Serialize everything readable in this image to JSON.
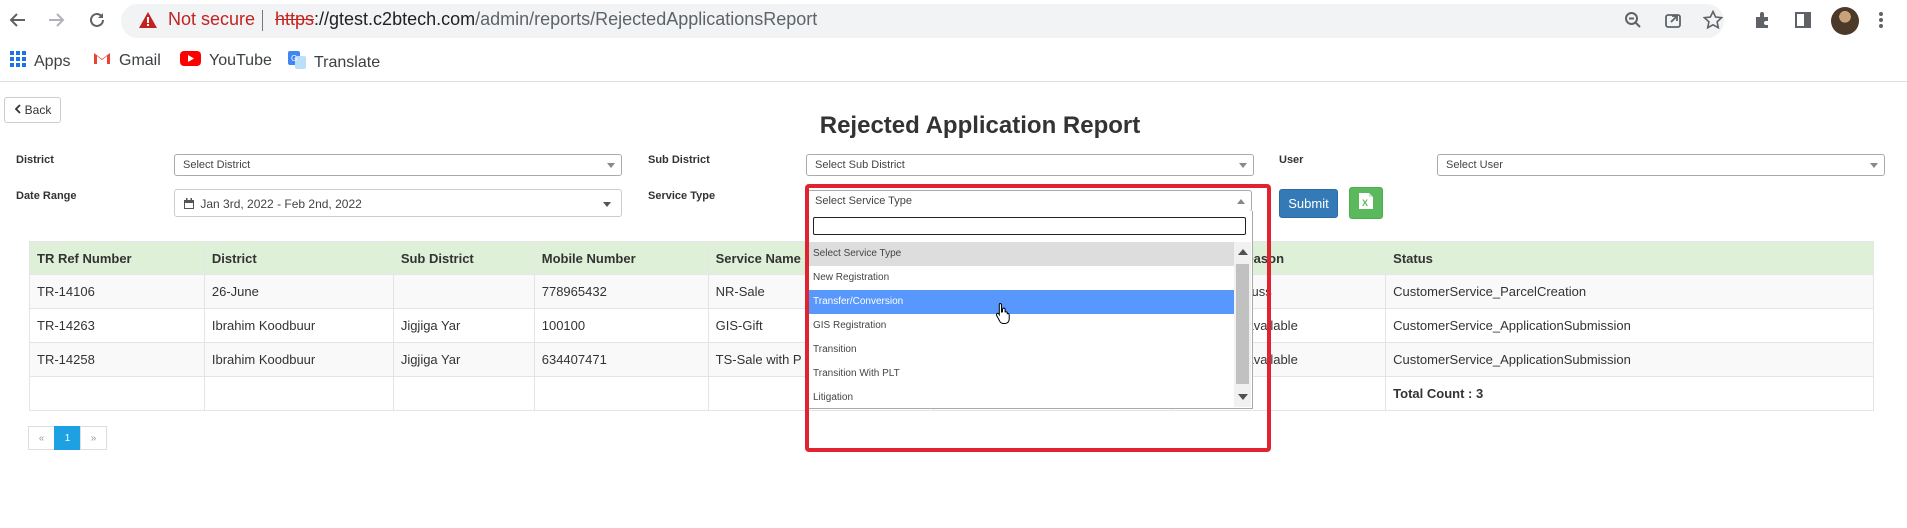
{
  "browser": {
    "not_secure": "Not secure",
    "url_scheme": "https",
    "url_host": "://gtest.c2btech.com",
    "url_path": "/admin/reports/RejectedApplicationsReport",
    "bookmarks": [
      "Apps",
      "Gmail",
      "YouTube",
      "Translate"
    ]
  },
  "page": {
    "back_label": "Back",
    "title": "Rejected Application Report"
  },
  "filters": {
    "district_label": "District",
    "district_value": "Select District",
    "subdistrict_label": "Sub District",
    "subdistrict_value": "Select Sub District",
    "user_label": "User",
    "user_value": "Select User",
    "date_label": "Date Range",
    "date_value": "Jan 3rd, 2022 - Feb 2nd, 2022",
    "service_label": "Service Type",
    "service_value": "Select Service Type",
    "submit_label": "Submit"
  },
  "service_dropdown": {
    "search_value": "",
    "options": [
      "Select Service Type",
      "New Registration",
      "Transfer/Conversion",
      "GIS Registration",
      "Transition",
      "Transition With PLT",
      "Litigation"
    ],
    "selected_index": 0,
    "hover_index": 2
  },
  "table": {
    "headers": [
      "TR Ref Number",
      "District",
      "Sub District",
      "Mobile Number",
      "Service Name",
      "",
      "Rejected Reason",
      "Status"
    ],
    "rows": [
      [
        "TR-14106",
        "26-June",
        "",
        "778965432",
        "NR-Sale",
        "",
        "Need to discuss",
        "CustomerService_ParcelCreation"
      ],
      [
        "TR-14263",
        "Ibrahim Koodbuur",
        "Jigjiga Yar",
        "100100",
        "GIS-Gift",
        "",
        "Legacy not available",
        "CustomerService_ApplicationSubmission"
      ],
      [
        "TR-14258",
        "Ibrahim Koodbuur",
        "Jigjiga Yar",
        "634407471",
        "TS-Sale with P",
        "",
        "Legacy not available",
        "CustomerService_ApplicationSubmission"
      ]
    ],
    "total": "Total Count : 3"
  },
  "pagination": {
    "prev": "«",
    "current": "1",
    "next": "»"
  },
  "colors": {
    "table_header_bg": "#dff0d8",
    "submit_bg": "#337ab7",
    "excel_bg": "#5cb85c",
    "dropdown_hover": "#5897fb",
    "highlight": "#e0242f",
    "pager_active": "#1ea1e3"
  },
  "icons": [
    "back-arrow-icon",
    "forward-arrow-icon",
    "reload-icon",
    "warning-icon",
    "zoom-icon",
    "share-icon",
    "star-icon",
    "extensions-icon",
    "side-panel-icon",
    "menu-icon",
    "apps-icon",
    "gmail-icon",
    "youtube-icon",
    "translate-icon",
    "calendar-icon",
    "excel-icon",
    "hand-cursor-icon"
  ]
}
